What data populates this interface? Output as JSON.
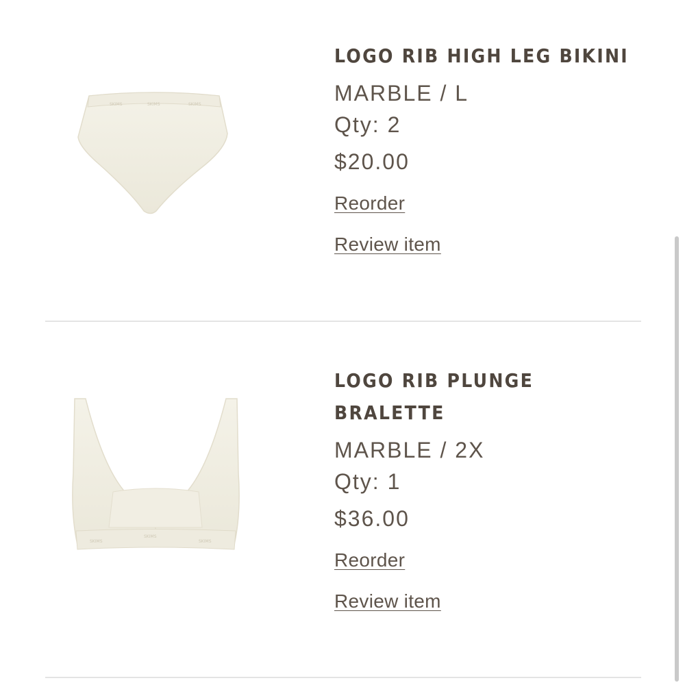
{
  "order_items": [
    {
      "title_lines": [
        "LOGO RIB HIGH LEG BIKINI"
      ],
      "variant": "MARBLE / L",
      "quantity": "Qty: 2",
      "price": "$20.00",
      "reorder_label": "Reorder",
      "review_label": "Review item",
      "image_icon": "bikini-product-image",
      "product_color": "#f2efe4"
    },
    {
      "title_lines": [
        "LOGO RIB PLUNGE",
        "BRALETTE"
      ],
      "variant": "MARBLE / 2X",
      "quantity": "Qty: 1",
      "price": "$36.00",
      "reorder_label": "Reorder",
      "review_label": "Review item",
      "image_icon": "bralette-product-image",
      "product_color": "#f2efe4"
    }
  ],
  "colors": {
    "text": "#5e544b",
    "title": "#4f463e",
    "divider": "#e4e4e4",
    "background": "#ffffff"
  }
}
